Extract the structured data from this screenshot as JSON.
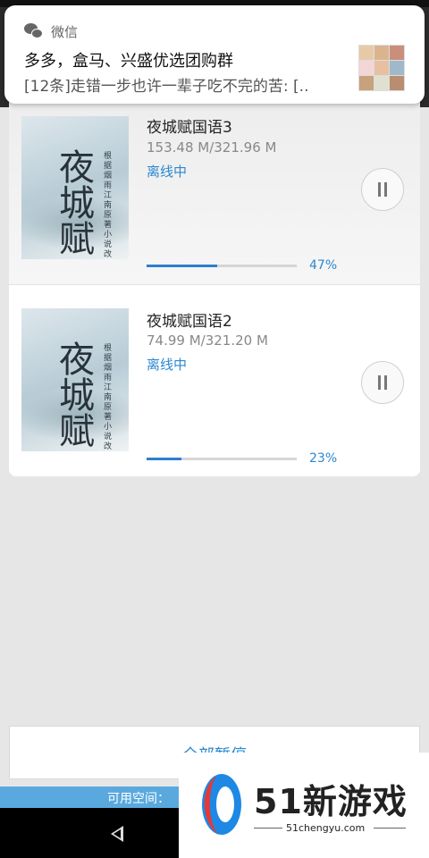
{
  "notification": {
    "app_name": "微信",
    "title": "多多，盒马、兴盛优选团购群",
    "body": "[12条]走错一步也许一辈子吃不完的苦: [.."
  },
  "downloads": [
    {
      "title": "夜城赋国语3",
      "size": "153.48 M/321.96 M",
      "status": "离线中",
      "progress_percent": 47,
      "progress_label": "47%",
      "cover_title": "夜城赋",
      "cover_subtitle": "根据烟雨江南原著小说改编"
    },
    {
      "title": "夜城赋国语2",
      "size": "74.99 M/321.20 M",
      "status": "离线中",
      "progress_percent": 23,
      "progress_label": "23%",
      "cover_title": "夜城赋",
      "cover_subtitle": "根据烟雨江南原著小说改编"
    }
  ],
  "footer": {
    "all_start_label": "全部暂停",
    "storage_label": "可用空间："
  },
  "watermark": {
    "text": "51新游戏",
    "url": "51chengyu.com"
  },
  "colors": {
    "accent": "#2a88d0",
    "storage_bar": "#5aa9de",
    "background": "#e6e6e6"
  },
  "icons": [
    "wechat-icon",
    "pause-icon",
    "back-icon"
  ]
}
